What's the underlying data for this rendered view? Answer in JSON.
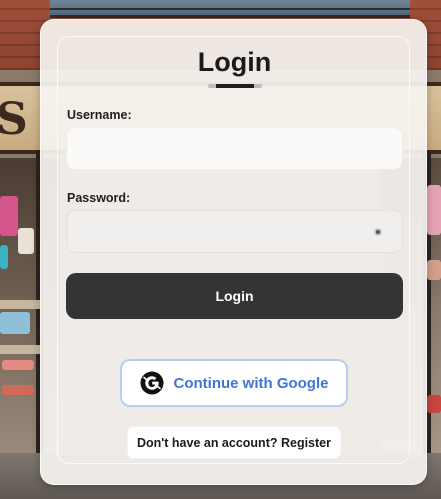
{
  "login": {
    "title": "Login",
    "username_label": "Username:",
    "username_value": "",
    "password_label": "Password:",
    "password_value": "",
    "submit_label": "Login",
    "google_label": "Continue with Google",
    "register_label": "Don't have an account? Register"
  },
  "icons": {
    "google": "google-g-icon",
    "password_toggle": "eye-icon"
  },
  "colors": {
    "submit_bg": "#343434",
    "google_text": "#3f76d6",
    "google_border": "#b9cdf0"
  }
}
